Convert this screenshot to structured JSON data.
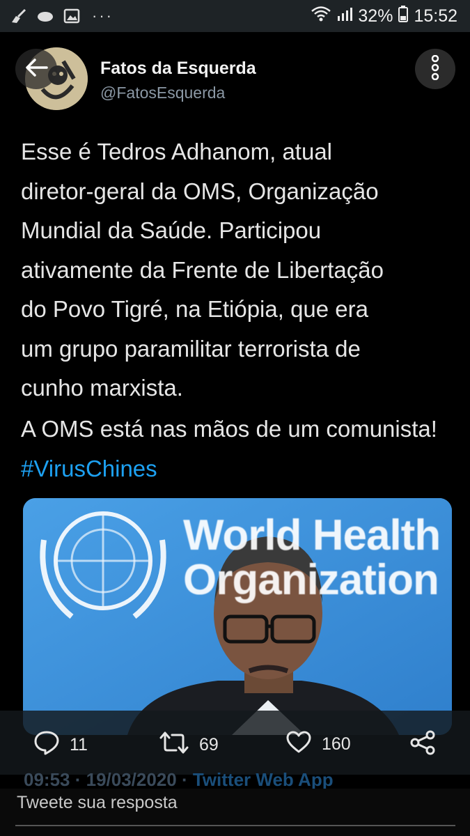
{
  "status_bar": {
    "battery": "32%",
    "time": "15:52",
    "more": "···"
  },
  "profile": {
    "name": "Fatos da Esquerda",
    "handle": "@FatosEsquerda"
  },
  "tweet": {
    "paragraph1": "Esse é Tedros Adhanom, atual\ndiretor-geral da OMS, Organização\nMundial da Saúde. Participou\nativamente da Frente de Libertação\ndo Povo Tigré, na Etiópia, que era\num grupo paramilitar terrorista de\ncunho marxista.",
    "paragraph2_text": "A OMS está nas mãos de um comunista! ",
    "hashtag": "#VirusChines"
  },
  "media": {
    "banner_line1": "World Health",
    "banner_line2": "Organization"
  },
  "actions": {
    "replies": "11",
    "retweets": "69",
    "likes": "160"
  },
  "meta": {
    "time": "09:53",
    "separator": " · ",
    "date": "19/03/2020",
    "app": "Twitter Web App"
  },
  "reply_box": {
    "placeholder": "Tweete sua resposta"
  },
  "colors": {
    "accent": "#1da1f2",
    "background": "#000000"
  }
}
